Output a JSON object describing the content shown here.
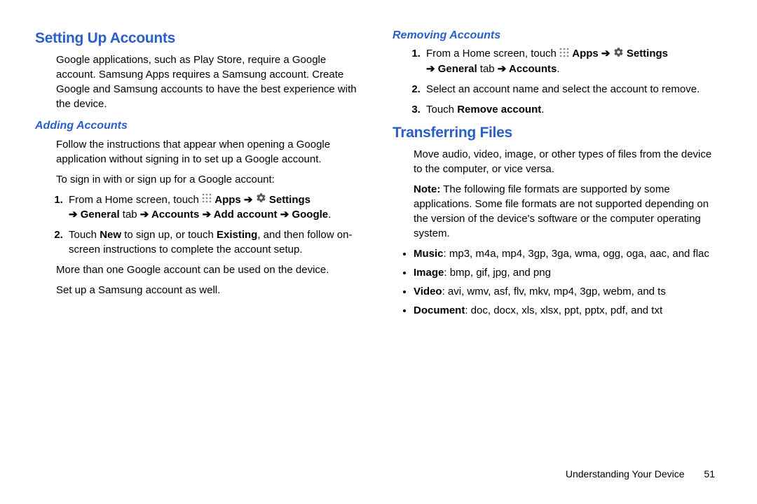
{
  "icons": {
    "apps": "apps-grid-icon",
    "settings": "settings-gear-icon"
  },
  "arrow": "➔",
  "left": {
    "h_setting_up": "Setting Up Accounts",
    "p_intro": "Google applications, such as Play Store, require a Google account. Samsung Apps requires a Samsung account. Create Google and Samsung accounts to have the best experience with the device.",
    "h_adding": "Adding Accounts",
    "p_follow": "Follow the instructions that appear when opening a Google application without signing in to set up a Google account.",
    "p_signin": "To sign in with or sign up for a Google account:",
    "step1_pre": "From a Home screen, touch ",
    "step1_apps": "Apps",
    "step1_settings": "Settings",
    "step1_tail": " General",
    "step1_tab": " tab ",
    "step1_accounts": " Accounts ",
    "step1_add": " Add account ",
    "step1_google": " Google",
    "step2_a": "Touch ",
    "step2_new": "New",
    "step2_b": " to sign up, or touch ",
    "step2_existing": "Existing",
    "step2_c": ", and then follow on-screen instructions to complete the account setup.",
    "p_more": "More than one Google account can be used on the device.",
    "p_setup_samsung": "Set up a Samsung account as well."
  },
  "right": {
    "h_removing": "Removing Accounts",
    "r1_pre": "From a Home screen, touch ",
    "r1_apps": "Apps",
    "r1_settings": "Settings",
    "r1_general": " General",
    "r1_tab": " tab ",
    "r1_accounts": " Accounts",
    "r2": "Select an account name and select the account to remove.",
    "r3_a": "Touch ",
    "r3_b": "Remove account",
    "h_transfer": "Transferring Files",
    "p_move": "Move audio, video, image, or other types of files from the device to the computer, or vice versa.",
    "note_label": "Note:",
    "note_body": " The following file formats are supported by some applications. Some file formats are not supported depending on the version of the device's software or the computer operating system.",
    "music_l": "Music",
    "music_v": ": mp3, m4a, mp4, 3gp, 3ga, wma, ogg, oga, aac, and flac",
    "image_l": "Image",
    "image_v": ": bmp, gif, jpg, and png",
    "video_l": "Video",
    "video_v": ": avi, wmv, asf, flv, mkv, mp4, 3gp, webm, and ts",
    "doc_l": "Document",
    "doc_v": ": doc, docx, xls, xlsx, ppt, pptx, pdf, and txt"
  },
  "footer": {
    "section": "Understanding Your Device",
    "page": "51"
  }
}
